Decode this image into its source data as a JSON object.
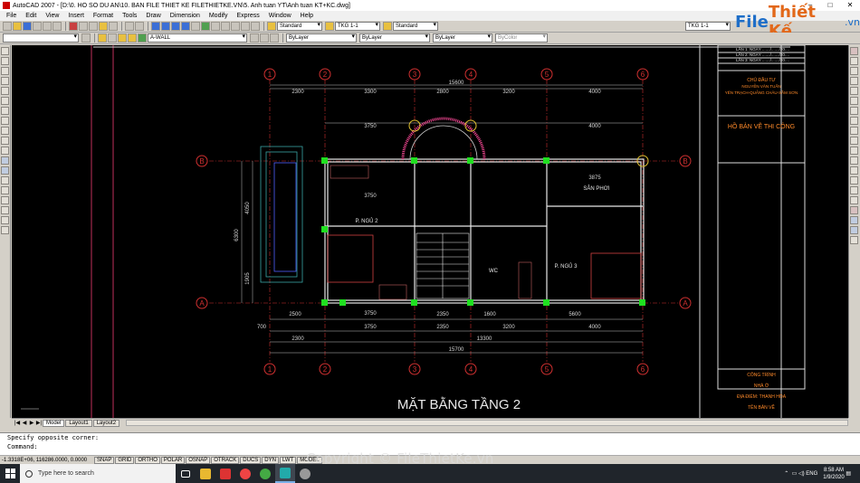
{
  "window": {
    "title": "AutoCAD 2007 - [D:\\0. HO SO DU AN\\10. BAN FILE THIET KE FILETHIETKE.VN\\5. Anh tuan YT\\Anh tuan KT+KC.dwg]"
  },
  "menu": [
    "File",
    "Edit",
    "View",
    "Insert",
    "Format",
    "Tools",
    "Draw",
    "Dimension",
    "Modify",
    "Express",
    "Window",
    "Help"
  ],
  "toolbar": {
    "text_style": "Standard",
    "dim_style": "TKG 1-1",
    "table_style": "Standard",
    "scale_style": "TKG 1-1",
    "layer": "A-WALL",
    "color": "ByLayer",
    "linetype": "ByLayer",
    "lineweight": "ByLayer",
    "plotstyle": "ByColor"
  },
  "logo": {
    "part1": "File",
    "part2": "Thiết Kế",
    "part3": ".vn"
  },
  "drawing": {
    "title": "MẶT BẰNG TẦNG 2",
    "grid_numbers": [
      "1",
      "2",
      "3",
      "4",
      "5",
      "6"
    ],
    "grid_letters_top": "B",
    "grid_letters_bottom": "A",
    "dims_top_row1": [
      "2300",
      "3300",
      "2800",
      "3200",
      "4000"
    ],
    "dims_top_total": "15600",
    "dims_top_row2": [
      "3750",
      "4000"
    ],
    "dims_inner": [
      "3750",
      "3875",
      "3750"
    ],
    "dims_bottom_row1": [
      "2500",
      "3750",
      "2350",
      "1600",
      "5600"
    ],
    "dims_bottom_row2": [
      "700",
      "3750",
      "2350",
      "3200",
      "4000"
    ],
    "dims_bottom_row3": [
      "2300",
      "13300"
    ],
    "dims_bottom_total": "15700",
    "dims_left": [
      "6300",
      "4050",
      "1905"
    ],
    "rooms": [
      "P. NGỦ 2",
      "SÂN PHƠI",
      "WC",
      "P. NGỦ 3"
    ],
    "title_block": {
      "revisions": [
        "LẦN 1: NGÀY ......./......./20....",
        "LẦN 2: NGÀY ......./......./20....",
        "LẦN 3: NGÀY ......./......./20...."
      ],
      "owner_label": "CHỦ ĐẦU TƯ",
      "owner_name": "NGUYỄN VĂN TUẤN",
      "address": "YÊN TRẠCH-QUẢNG CHÂU-SẦM SƠN",
      "phase": "HỒ BẢN VẼ THI CÔNG",
      "project_label": "CÔNG TRÌNH",
      "project_name": "NHÀ Ở",
      "location": "ĐỊA ĐIỂM: THANH HÓA",
      "sheet_label": "TÊN BẢN VẼ"
    }
  },
  "tabs": [
    "Model",
    "Layout1",
    "Layout2"
  ],
  "command": {
    "line1": "Specify opposite corner:",
    "line2": "Command:"
  },
  "status": {
    "coords": "-1.3318E+06, 116286.0000, 0.0000",
    "toggles": [
      "SNAP",
      "GRID",
      "ORTHO",
      "POLAR",
      "OSNAP",
      "OTRACK",
      "DUCS",
      "DYN",
      "LWT",
      "MODEL"
    ]
  },
  "taskbar": {
    "search_placeholder": "Type here to search",
    "tray_lang": "ENG",
    "time": "8:58 AM",
    "date": "1/9/2020"
  },
  "watermark": "Copyright © FileThietKe.vn"
}
